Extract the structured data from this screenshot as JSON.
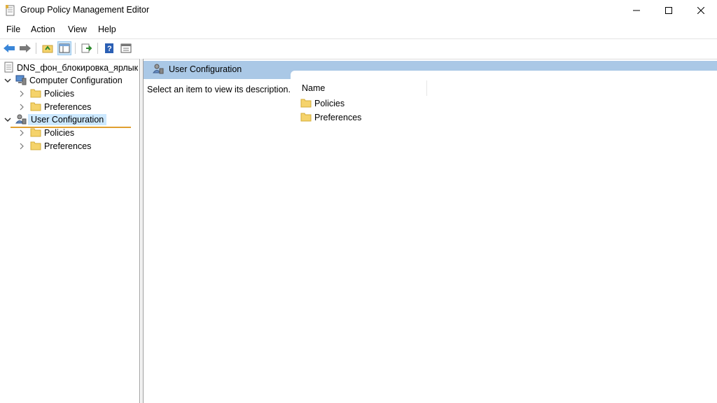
{
  "window": {
    "title": "Group Policy Management Editor"
  },
  "menu": {
    "items": [
      "File",
      "Action",
      "View",
      "Help"
    ]
  },
  "toolbar": {
    "buttons": [
      "back-icon",
      "forward-icon",
      "up-folder-icon",
      "show-hide-tree-icon",
      "export-list-icon",
      "help-icon",
      "properties-icon"
    ]
  },
  "tree": {
    "root": "DNS_фон_блокировка_ярлык",
    "computer_config": "Computer Configuration",
    "computer_policies": "Policies",
    "computer_preferences": "Preferences",
    "user_config": "User Configuration",
    "user_policies": "Policies",
    "user_preferences": "Preferences"
  },
  "content": {
    "header_title": "User Configuration",
    "description": "Select an item to view its description.",
    "column_name": "Name",
    "items": [
      "Policies",
      "Preferences"
    ]
  },
  "colors": {
    "header_bg": "#aac8e6",
    "selection_bg": "#cce8ff",
    "folder": "#f5d36b",
    "focus_line": "#e0a030"
  }
}
